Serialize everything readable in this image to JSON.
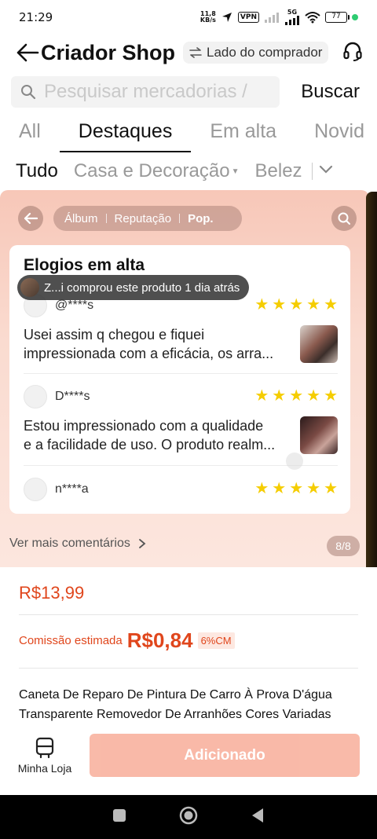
{
  "status_bar": {
    "time": "21:29",
    "speed_value": "11,8",
    "speed_unit": "KB/s",
    "vpn": "VPN",
    "network": "5G",
    "battery": "77"
  },
  "header": {
    "title": "Criador Shop",
    "buyer_side": "Lado do comprador"
  },
  "search": {
    "placeholder": "Pesquisar mercadorias / ",
    "button": "Buscar"
  },
  "tabs": [
    {
      "label": "All",
      "active": false
    },
    {
      "label": "Destaques",
      "active": true
    },
    {
      "label": "Em alta",
      "active": false
    },
    {
      "label": "Novid",
      "active": false
    }
  ],
  "categories": [
    {
      "label": "Tudo",
      "active": true
    },
    {
      "label": "Casa e Decoração",
      "active": false
    },
    {
      "label": "Belez",
      "active": false
    }
  ],
  "review_panel": {
    "segments": [
      "Álbum",
      "Reputação",
      "Pop."
    ],
    "active_segment": "Pop.",
    "card_title": "Elogios em alta",
    "toast": "Z...i comprou este produto 1 dia atrás",
    "reviews": [
      {
        "user": "@****s",
        "stars": 5,
        "line1": "Usei assim q chegou e fiquei",
        "line2": "impressionada com a eficácia, os arra..."
      },
      {
        "user": "D****s",
        "stars": 5,
        "line1": "Estou impressionado com a qualidade",
        "line2": "e a facilidade de uso. O produto realm..."
      },
      {
        "user": "n****a",
        "stars": 5
      }
    ],
    "more_comments": "Ver mais comentários",
    "pager": "8/8",
    "accent_color": "#f5cd00"
  },
  "product": {
    "price": "R$13,99",
    "commission_label": "Comissão estimada",
    "commission_value": "R$0,84",
    "commission_badge": "6%CM",
    "title_line1": "Caneta De Reparo De Pintura De Carro À Prova D'água",
    "title_line2": "Transparente Removedor De Arranhões Cores Variadas"
  },
  "bottom_bar": {
    "store_label": "Minha Loja",
    "added_button": "Adicionado"
  },
  "colors": {
    "brand": "#e0461c",
    "button": "#f9b6a4"
  }
}
